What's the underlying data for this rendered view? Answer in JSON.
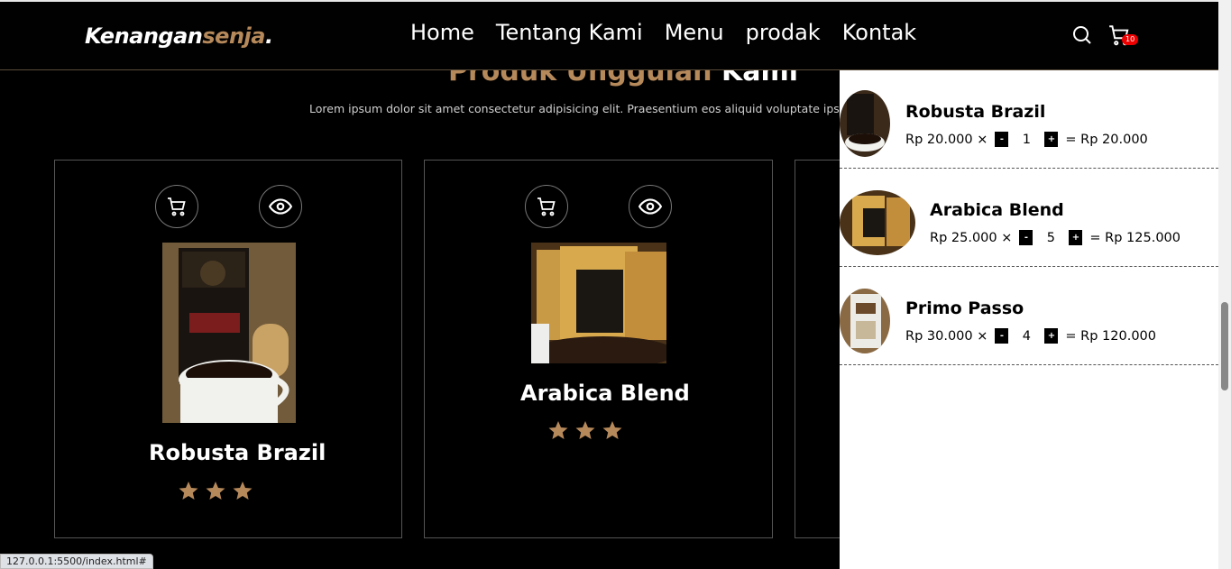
{
  "navbar": {
    "logo_main": "Kenangan",
    "logo_accent": "senja",
    "logo_dot": ".",
    "links": [
      "Home",
      "Tentang Kami",
      "Menu",
      "prodak",
      "Kontak"
    ],
    "icons": [
      "search-icon",
      "cart-icon"
    ],
    "cart_count": "10"
  },
  "products": {
    "title_accent": "Produk Unggulan",
    "title_white": "Kami",
    "description": "Lorem ipsum dolor sit amet consectetur adipisicing elit. Praesentium eos aliquid voluptate ipsam f",
    "items": [
      {
        "name": "Robusta Brazil",
        "stars": 3
      },
      {
        "name": "Arabica Blend",
        "stars": 3
      }
    ]
  },
  "cart": {
    "items": [
      {
        "name": "Robusta Brazil",
        "price": "Rp 20.000 ×",
        "minus": "-",
        "qty": "1",
        "plus": "+",
        "total": "= Rp 20.000"
      },
      {
        "name": "Arabica Blend",
        "price": "Rp 25.000 ×",
        "minus": "-",
        "qty": "5",
        "plus": "+",
        "total": "= Rp 125.000"
      },
      {
        "name": "Primo Passo",
        "price": "Rp 30.000 ×",
        "minus": "-",
        "qty": "4",
        "plus": "+",
        "total": "= Rp 120.000"
      }
    ]
  },
  "statusbar": {
    "url": "127.0.0.1:5500/index.html#"
  },
  "colors": {
    "accent": "#b6895b",
    "badge": "#e00000",
    "background": "#000000"
  }
}
